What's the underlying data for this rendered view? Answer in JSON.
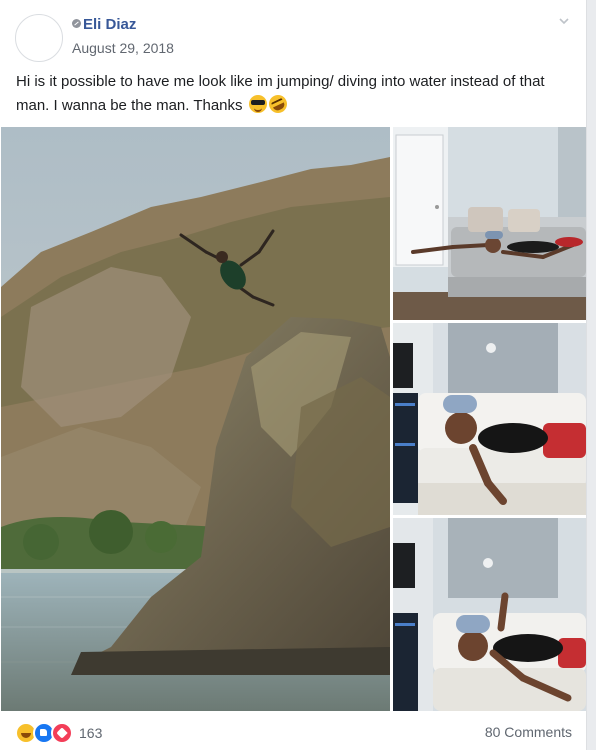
{
  "post": {
    "author": "Eli Diaz",
    "date": "August 29, 2018",
    "text": "Hi is it possible to have me look like im jumping/ diving into water instead of that man. I wanna be the man. Thanks",
    "emojis": [
      "smiling-face-with-sunglasses",
      "rolling-on-the-floor-laughing"
    ]
  },
  "photos": [
    {
      "subject": "man diving off a large rock into a lake with hills behind"
    },
    {
      "subject": "man lying on white sofa in diving pose"
    },
    {
      "subject": "man in cap lying on white sofa, arm reaching forward"
    },
    {
      "subject": "man in cap lying on white sofa, arm stretched down"
    }
  ],
  "footer": {
    "reaction_icons": [
      "haha-icon",
      "like-icon",
      "love-icon"
    ],
    "reaction_count": "163",
    "comments": "80 Comments"
  },
  "colors": {
    "name_link": "#385898",
    "secondary_text": "#616770",
    "like_blue": "#1877f2",
    "love_red": "#f33e58",
    "haha_yellow": "#f7c02b"
  }
}
